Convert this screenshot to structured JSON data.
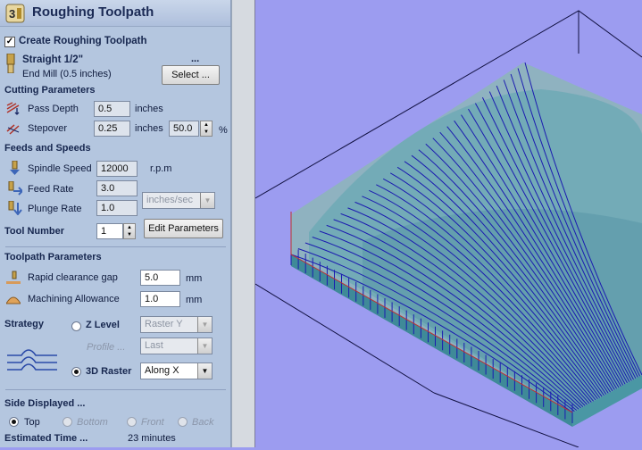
{
  "panel": {
    "title": "Roughing Toolpath",
    "create_checkbox": {
      "label": "Create Roughing Toolpath",
      "checked": true
    },
    "tool": {
      "name": "Straight 1/2\"",
      "desc": "End Mill (0.5 inches)",
      "ellipsis": "...",
      "select_button": "Select ..."
    },
    "cutting": {
      "header": "Cutting Parameters",
      "pass_depth_label": "Pass Depth",
      "pass_depth_value": "0.5",
      "pass_depth_unit": "inches",
      "stepover_label": "Stepover",
      "stepover_value": "0.25",
      "stepover_unit": "inches",
      "stepover_percent": "50.0",
      "percent_sign": "%"
    },
    "feeds": {
      "header": "Feeds and Speeds",
      "spindle_label": "Spindle Speed",
      "spindle_value": "12000",
      "spindle_unit": "r.p.m",
      "feed_label": "Feed Rate",
      "feed_value": "3.0",
      "plunge_label": "Plunge Rate",
      "plunge_value": "1.0",
      "rate_unit": "inches/sec",
      "tool_number_label": "Tool Number",
      "tool_number_value": "1",
      "edit_button": "Edit Parameters"
    },
    "toolpath": {
      "header": "Toolpath Parameters",
      "rapid_label": "Rapid clearance gap",
      "rapid_value": "5.0",
      "rapid_unit": "mm",
      "allowance_label": "Machining Allowance",
      "allowance_value": "1.0",
      "allowance_unit": "mm"
    },
    "strategy": {
      "label": "Strategy",
      "zlevel_label": "Z Level",
      "zlevel_value": "Raster Y",
      "profile_label": "Profile ...",
      "profile_value": "Last",
      "raster_label": "3D Raster",
      "raster_value": "Along X",
      "selected": "3D Raster"
    },
    "side": {
      "header": "Side Displayed ...",
      "options": [
        "Top",
        "Bottom",
        "Front",
        "Back"
      ],
      "selected": "Top"
    },
    "estimate": {
      "label": "Estimated Time ...",
      "value": "23 minutes"
    }
  },
  "colors": {
    "panel_bg": "#b4c6df",
    "viewport_bg": "#9c9cf0",
    "toolpath_line": "#1b1bb0",
    "block_top": "#6fa9b5",
    "block_side": "#3f8a98"
  },
  "icons": {
    "title": "roughing-toolpath-icon",
    "tool": "end-mill-icon",
    "pass_depth": "pass-depth-icon",
    "stepover": "stepover-icon",
    "spindle": "spindle-speed-icon",
    "feed": "feed-rate-icon",
    "plunge": "plunge-rate-icon",
    "rapid": "rapid-clearance-icon",
    "allowance": "machining-allowance-icon",
    "strategy": "strategy-preview-icon"
  }
}
